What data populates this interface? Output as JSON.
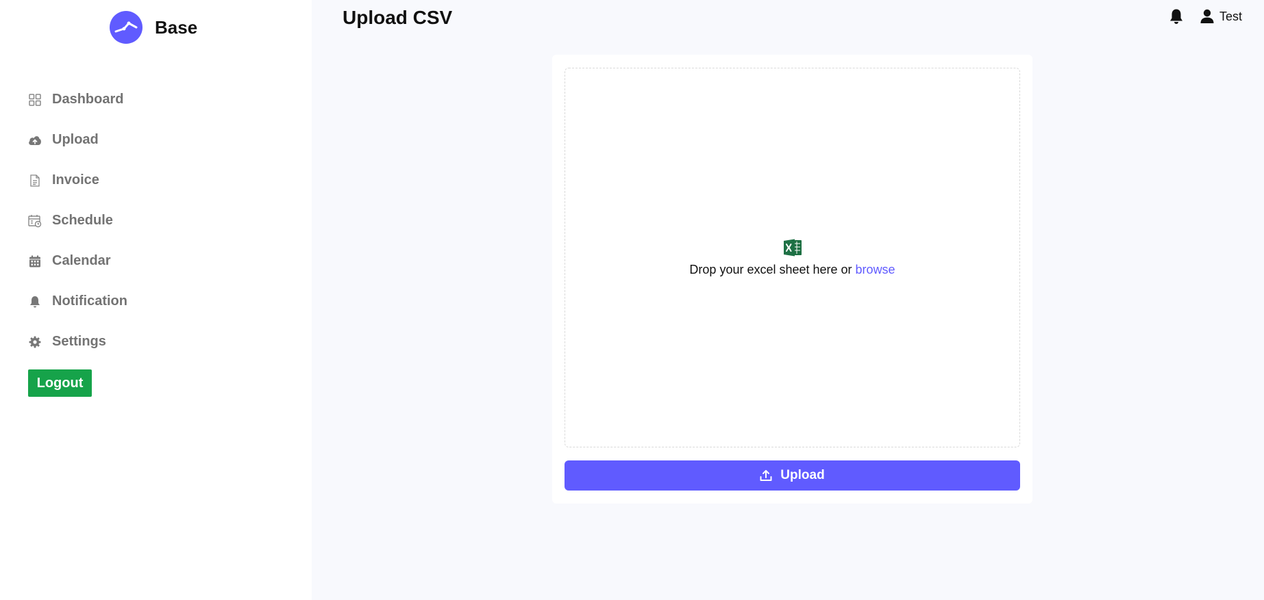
{
  "brand": {
    "name": "Base",
    "accent": "#605bff"
  },
  "sidebar": {
    "items": [
      {
        "label": "Dashboard",
        "icon": "dashboard-icon"
      },
      {
        "label": "Upload",
        "icon": "cloud-upload-icon"
      },
      {
        "label": "Invoice",
        "icon": "document-icon"
      },
      {
        "label": "Schedule",
        "icon": "schedule-icon"
      },
      {
        "label": "Calendar",
        "icon": "calendar-icon"
      },
      {
        "label": "Notification",
        "icon": "bell-icon"
      },
      {
        "label": "Settings",
        "icon": "gear-icon"
      }
    ],
    "logout_label": "Logout",
    "logout_color": "#16a34a"
  },
  "header": {
    "title": "Upload CSV",
    "user_name": "Test",
    "notification_icon": "bell-icon",
    "user_icon": "user-icon"
  },
  "upload": {
    "file_icon": "excel-icon",
    "drop_text": "Drop your excel sheet here or ",
    "browse_label": "browse",
    "button_label": "Upload",
    "button_icon": "upload-icon"
  }
}
